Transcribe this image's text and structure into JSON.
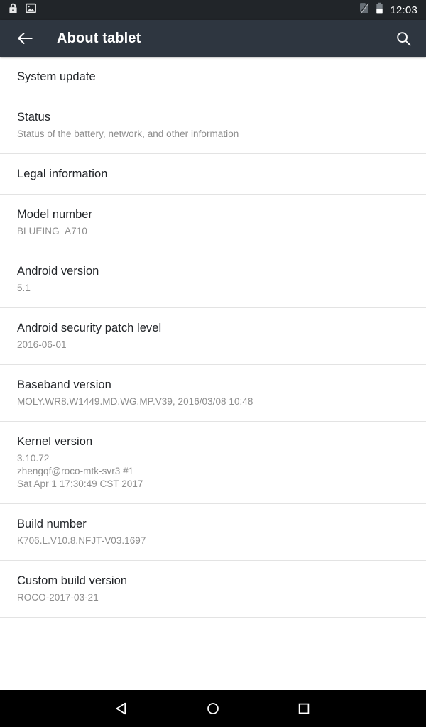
{
  "status_bar": {
    "left_icons": [
      {
        "name": "lock-icon",
        "label": "Screen locked"
      },
      {
        "name": "screenshot-image-icon",
        "label": "Screenshot captured"
      }
    ],
    "right_icons": [
      {
        "name": "no-sim-icon",
        "label": "No SIM card"
      },
      {
        "name": "battery-icon",
        "label": "Battery"
      }
    ],
    "clock": "12:03"
  },
  "app_bar": {
    "back_label": "Navigate up",
    "title": "About tablet",
    "search_label": "Search"
  },
  "colors": {
    "status_bar_bg": "#212529",
    "app_bar_bg": "#2e3640",
    "content_bg": "#ffffff",
    "nav_bar_bg": "#000000",
    "primary_text": "#222529",
    "secondary_text": "#8d8d8d",
    "divider": "#e3e3e3"
  },
  "list": [
    {
      "key": "system-update",
      "title": "System update",
      "summary_lines": []
    },
    {
      "key": "status",
      "title": "Status",
      "summary_lines": [
        "Status of the battery, network, and other information"
      ]
    },
    {
      "key": "legal-information",
      "title": "Legal information",
      "summary_lines": []
    },
    {
      "key": "model-number",
      "title": "Model number",
      "summary_lines": [
        "BLUEING_A710"
      ]
    },
    {
      "key": "android-version",
      "title": "Android version",
      "summary_lines": [
        "5.1"
      ]
    },
    {
      "key": "android-security-patch-level",
      "title": "Android security patch level",
      "summary_lines": [
        "2016-06-01"
      ]
    },
    {
      "key": "baseband-version",
      "title": "Baseband version",
      "summary_lines": [
        "MOLY.WR8.W1449.MD.WG.MP.V39, 2016/03/08 10:48"
      ]
    },
    {
      "key": "kernel-version",
      "title": "Kernel version",
      "summary_lines": [
        "3.10.72",
        "zhengqf@roco-mtk-svr3 #1",
        "Sat Apr 1 17:30:49 CST 2017"
      ]
    },
    {
      "key": "build-number",
      "title": "Build number",
      "summary_lines": [
        "K706.L.V10.8.NFJT-V03.1697"
      ]
    },
    {
      "key": "custom-build-version",
      "title": "Custom build version",
      "summary_lines": [
        "ROCO-2017-03-21"
      ]
    }
  ],
  "nav_bar": {
    "back_label": "Back",
    "home_label": "Home",
    "recents_label": "Recent apps"
  }
}
